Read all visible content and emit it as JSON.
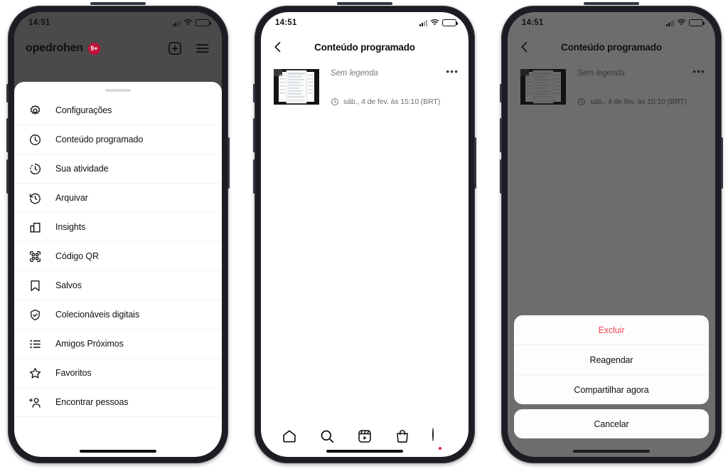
{
  "meta": {
    "accent_red": "#ed4956",
    "badge_red": "#c2103a",
    "dim_overlay": "#4a4a4a",
    "text_primary": "#111111",
    "text_muted": "#7b7b7b"
  },
  "status_bar": {
    "time": "14:51",
    "signal_icon": "cellular-signal-icon",
    "wifi_icon": "wifi-icon",
    "battery_icon": "battery-icon"
  },
  "phone1": {
    "header": {
      "username": "opedrohen",
      "badge": "9+",
      "add_icon": "plus-square-icon",
      "menu_icon": "hamburger-menu-icon"
    },
    "menu": {
      "grabber": "sheet-grab-handle",
      "items": [
        {
          "label": "Configurações",
          "icon": "gear-icon"
        },
        {
          "label": "Conteúdo programado",
          "icon": "clock-icon"
        },
        {
          "label": "Sua atividade",
          "icon": "activity-clock-icon"
        },
        {
          "label": "Arquivar",
          "icon": "archive-clock-icon"
        },
        {
          "label": "Insights",
          "icon": "bar-chart-icon"
        },
        {
          "label": "Código QR",
          "icon": "qr-code-icon"
        },
        {
          "label": "Salvos",
          "icon": "bookmark-icon"
        },
        {
          "label": "Colecionáveis digitais",
          "icon": "shield-check-icon"
        },
        {
          "label": "Amigos Próximos",
          "icon": "close-friends-list-icon"
        },
        {
          "label": "Favoritos",
          "icon": "star-icon"
        },
        {
          "label": "Encontrar pessoas",
          "icon": "add-person-icon"
        }
      ]
    }
  },
  "phone2": {
    "nav": {
      "back_icon": "chevron-left-icon",
      "title": "Conteúdo programado"
    },
    "post": {
      "thumbnail": "scheduled-post-thumbnail",
      "caption": "Sem legenda",
      "more_icon": "more-options-icon",
      "more_glyph": "•••",
      "schedule_icon": "clock-icon",
      "schedule_time": "sáb., 4 de fev. às 15:10 (BRT)"
    },
    "tabbar": [
      {
        "name": "home",
        "icon": "home-icon"
      },
      {
        "name": "search",
        "icon": "search-icon"
      },
      {
        "name": "reels",
        "icon": "reels-icon"
      },
      {
        "name": "shop",
        "icon": "shop-bag-icon"
      },
      {
        "name": "profile",
        "icon": "profile-avatar-icon"
      }
    ]
  },
  "phone3": {
    "nav": {
      "back_icon": "chevron-left-icon",
      "title": "Conteúdo programado"
    },
    "post": {
      "caption": "Sem legenda",
      "more_glyph": "•••",
      "schedule_time": "sáb., 4 de fev. às 15:10 (BRT)"
    },
    "action_sheet": {
      "options": [
        {
          "label": "Excluir",
          "style": "destructive"
        },
        {
          "label": "Reagendar",
          "style": "default"
        },
        {
          "label": "Compartilhar agora",
          "style": "default"
        }
      ],
      "cancel": "Cancelar"
    }
  }
}
